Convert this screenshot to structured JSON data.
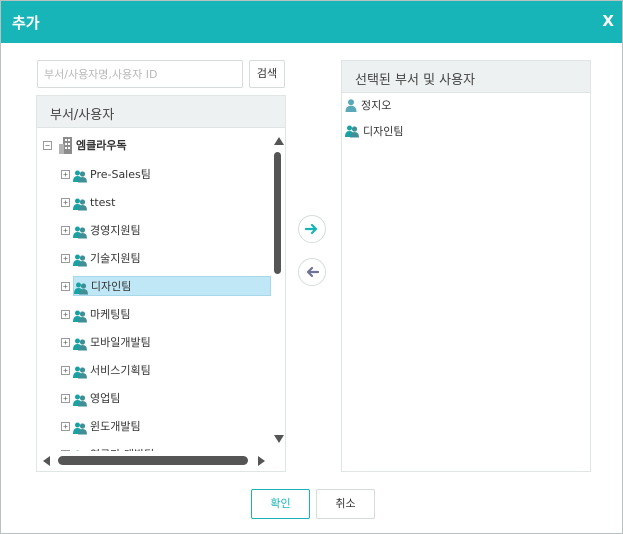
{
  "dialog": {
    "title": "추가",
    "close_label": "X"
  },
  "search": {
    "placeholder": "부서/사용자명,사용자 ID",
    "button_label": "검색"
  },
  "left_panel": {
    "header": "부서/사용자",
    "root": {
      "label": "엠클라우독",
      "expander": "⊟"
    },
    "items": [
      {
        "label": "Pre-Sales팀",
        "expander": "⊞"
      },
      {
        "label": "ttest",
        "expander": "⊞"
      },
      {
        "label": "경영지원팀",
        "expander": "⊞"
      },
      {
        "label": "기술지원팀",
        "expander": "⊞"
      },
      {
        "label": "디자인팀",
        "expander": "⊞",
        "selected": true
      },
      {
        "label": "마케팅팀",
        "expander": "⊞"
      },
      {
        "label": "모바일개발팀",
        "expander": "⊞"
      },
      {
        "label": "서비스기획팀",
        "expander": "⊞"
      },
      {
        "label": "영업팀",
        "expander": "⊞"
      },
      {
        "label": "윈도개발팀",
        "expander": "⊞"
      },
      {
        "label": "연구마 개발팀",
        "expander": "⊞"
      }
    ]
  },
  "right_panel": {
    "header": "선택된 부서 및 사용자",
    "items": [
      {
        "label": "정지오",
        "icon": "person-icon"
      },
      {
        "label": "디자인팀",
        "icon": "group-icon"
      }
    ]
  },
  "move_buttons": {
    "add_icon": "arrow-right-icon",
    "remove_icon": "arrow-left-icon"
  },
  "footer": {
    "ok_label": "확인",
    "cancel_label": "취소"
  },
  "colors": {
    "accent": "#17b5b8",
    "selected_row": "#bfe7f5",
    "group_icon": "#17a3a6",
    "person_icon": "#5aa9b9"
  }
}
